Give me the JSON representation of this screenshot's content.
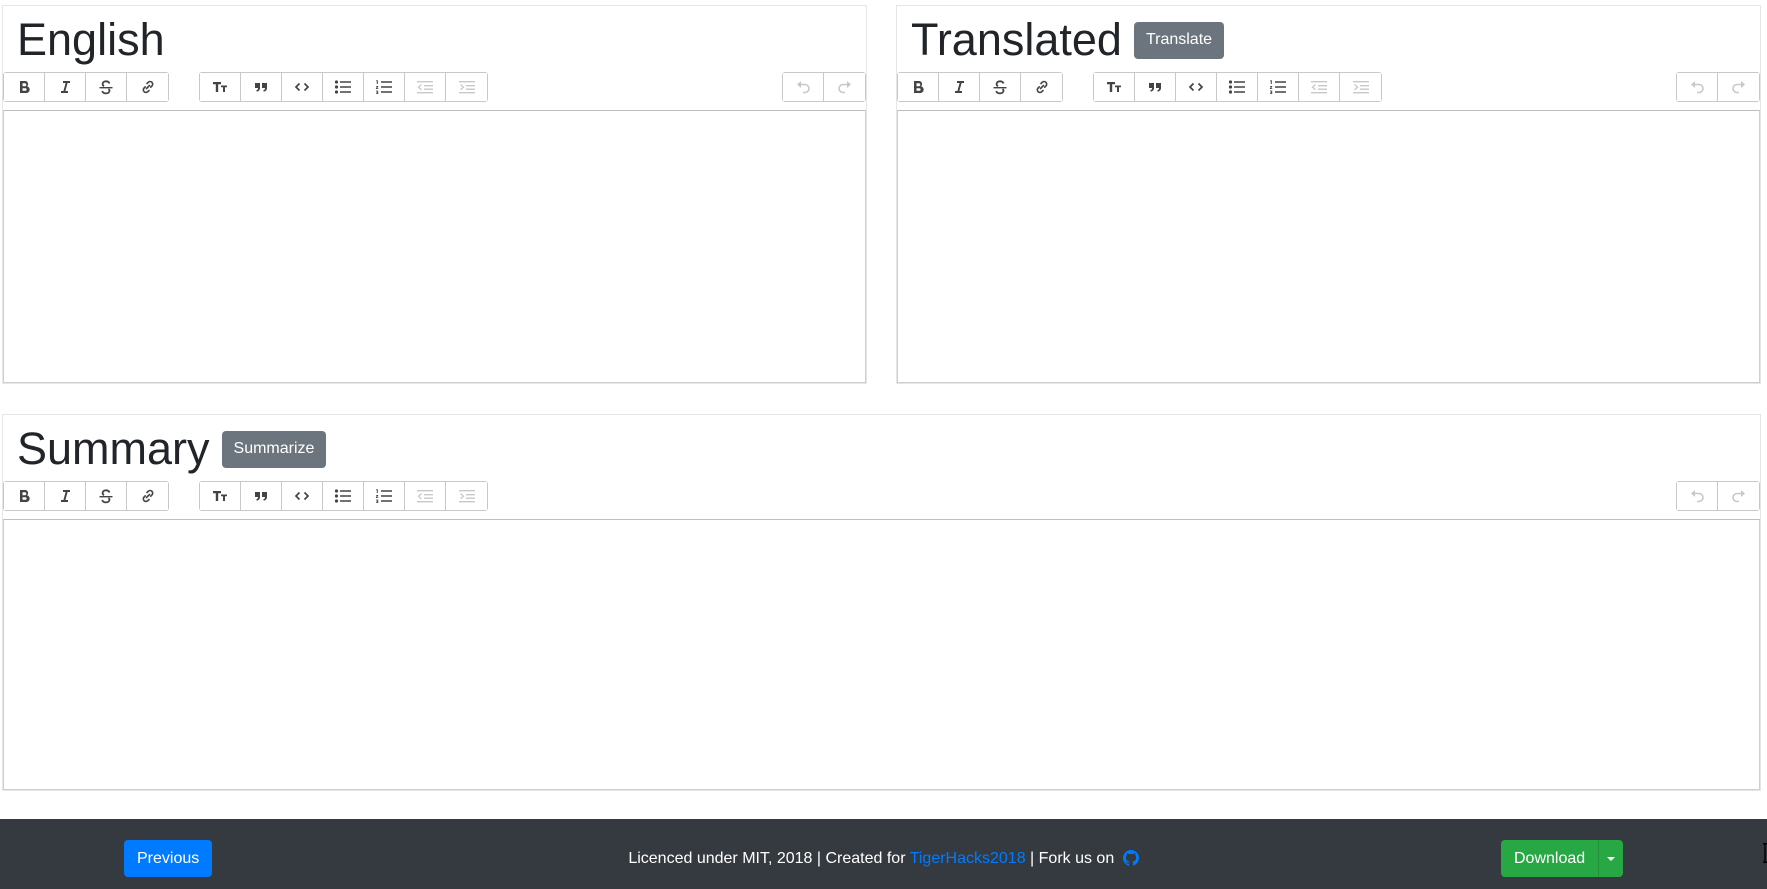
{
  "panels": {
    "english": {
      "title": "English"
    },
    "translated": {
      "title": "Translated",
      "button": "Translate"
    },
    "summary": {
      "title": "Summary",
      "button": "Summarize"
    }
  },
  "toolbar": {
    "icons": [
      "bold-icon",
      "italic-icon",
      "strikethrough-icon",
      "link-icon",
      "heading-icon",
      "quote-icon",
      "code-icon",
      "bullet-list-icon",
      "numbered-list-icon",
      "outdent-icon",
      "indent-icon",
      "undo-icon",
      "redo-icon"
    ]
  },
  "footer": {
    "previous": "Previous",
    "text_prefix": "Licenced under MIT, 2018 | Created for ",
    "link": "TigerHacks2018",
    "text_suffix": " | Fork us on ",
    "download": "Download"
  },
  "colors": {
    "footer_bg": "#343a40",
    "primary": "#007bff",
    "success": "#28a745",
    "secondary": "#6c757d"
  }
}
